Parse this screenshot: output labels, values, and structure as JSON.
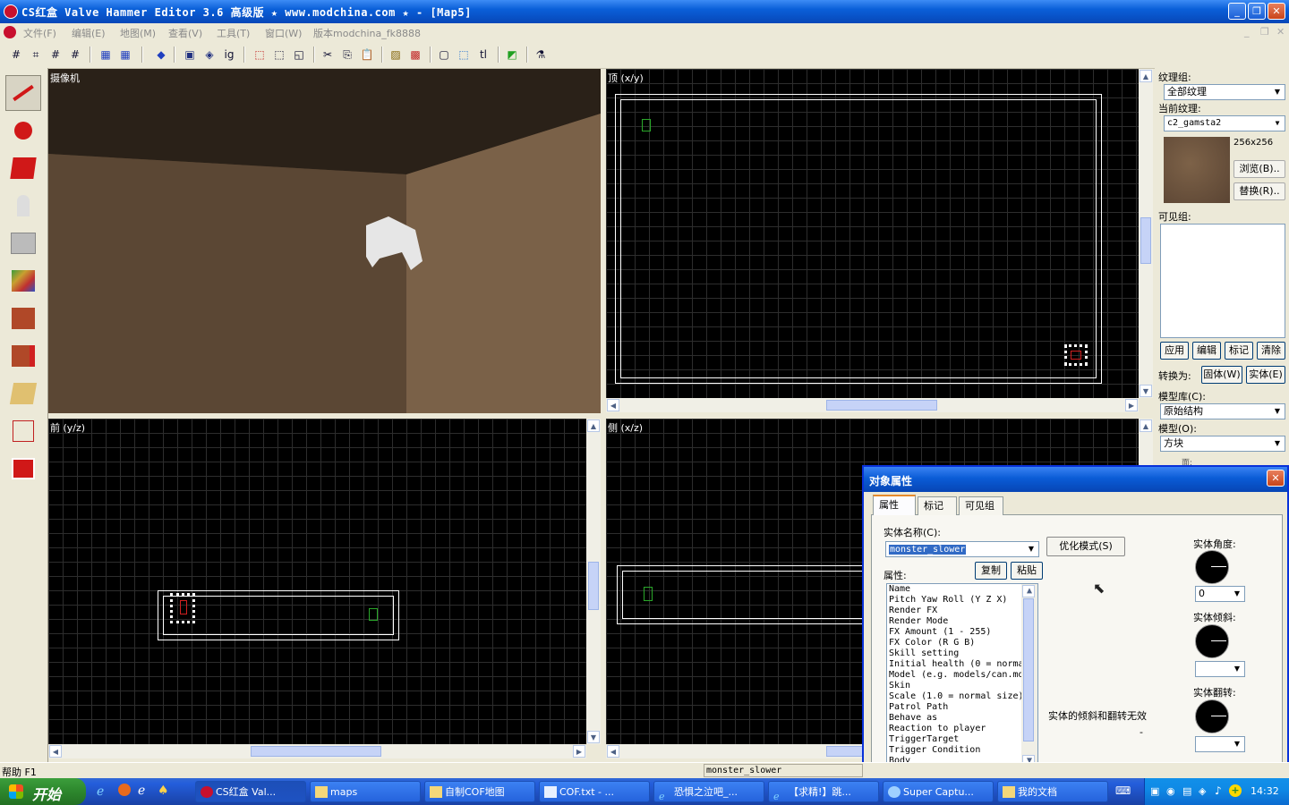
{
  "window": {
    "title": "CS红盒 Valve Hammer Editor 3.6 高级版 ★ www.modchina.com ★ - [Map5]"
  },
  "menu": [
    {
      "label": "文件(F)"
    },
    {
      "label": "编辑(E)"
    },
    {
      "label": "地图(M)"
    },
    {
      "label": "查看(V)"
    },
    {
      "label": "工具(T)"
    },
    {
      "label": "窗口(W)"
    },
    {
      "label": "版本modchina_fk8888"
    }
  ],
  "viewports": {
    "camera": {
      "label": "摄像机"
    },
    "top": {
      "label": "顶 (x/y)"
    },
    "front": {
      "label": "前 (y/z)"
    },
    "side": {
      "label": "侧 (x/z)"
    }
  },
  "texture_panel": {
    "group_label": "纹理组:",
    "group_value": "全部纹理",
    "current_label": "当前纹理:",
    "current_value": "c2_gamsta2",
    "size": "256x256",
    "browse_label": "浏览(B)..",
    "replace_label": "替换(R)..",
    "visgroup_label": "可见组:",
    "apply_label": "应用",
    "edit_label": "编辑",
    "mark_label": "标记",
    "clear_label": "清除",
    "convert_label": "转换为:",
    "to_world_label": "固体(W)",
    "to_entity_label": "实体(E)",
    "prefab_lib_label": "模型库(C):",
    "prefab_lib_value": "原始结构",
    "prefab_label": "模型(O):",
    "prefab_value": "方块",
    "faces_label": "面:"
  },
  "dialog": {
    "title": "对象属性",
    "tabs": [
      {
        "label": "属性"
      },
      {
        "label": "标记"
      },
      {
        "label": "可见组"
      }
    ],
    "class_label": "实体名称(C):",
    "class_value": "monster_slower",
    "smartedit_label": "优化模式(S)",
    "attrs_label": "属性:",
    "copy_label": "复制",
    "paste_label": "粘贴",
    "attributes": [
      "Name",
      "Pitch Yaw Roll (Y Z X)",
      "Render FX",
      "Render Mode",
      "FX Amount (1 - 255)",
      "FX Color (R G B)",
      "Skill setting",
      "Initial health (0 = norma",
      "Model (e.g. models/can.md",
      "Skin",
      "Scale (1.0 = normal size)",
      "Patrol Path",
      "Behave as",
      "Reaction to player",
      "TriggerTarget",
      "Trigger Condition",
      "Body"
    ],
    "angle_label": "实体角度:",
    "angle_value": "0",
    "pitch_label": "实体倾斜:",
    "roll_label": "实体翻转:",
    "note": "实体的倾斜和翻转无效",
    "dash": "-"
  },
  "status": {
    "help": "帮助 F1",
    "selection": "monster_slower"
  },
  "taskbar": {
    "start_label": "开始",
    "tasks": [
      {
        "label": "CS红盒 Val..."
      },
      {
        "label": "maps"
      },
      {
        "label": "自制COF地图"
      },
      {
        "label": "COF.txt - ..."
      },
      {
        "label": "恐惧之泣吧_..."
      },
      {
        "label": "【求精!】跳..."
      },
      {
        "label": "Super Captu..."
      },
      {
        "label": "我的文档"
      }
    ],
    "clock": "14:32"
  }
}
